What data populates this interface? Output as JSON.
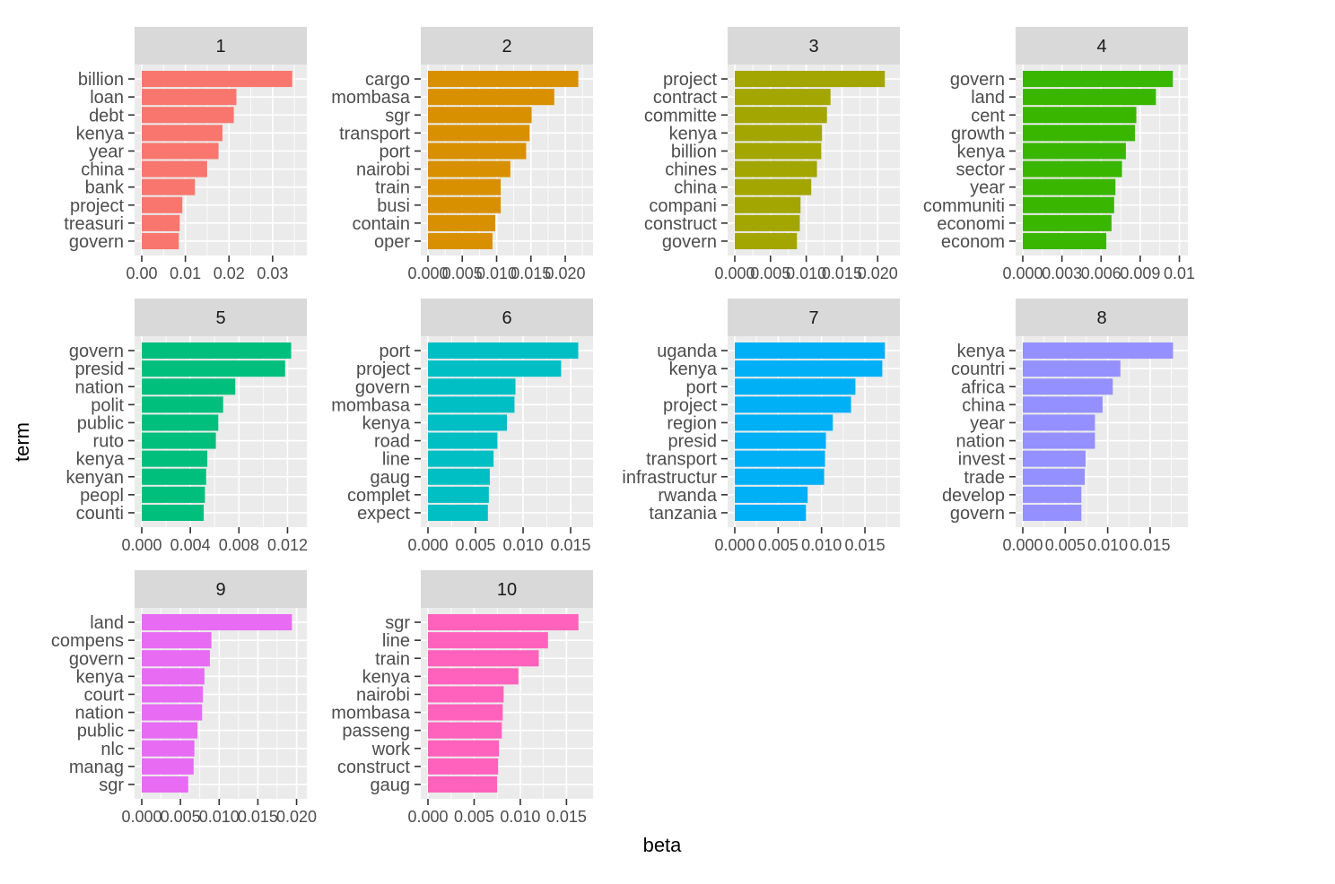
{
  "chart_data": {
    "type": "bar",
    "orientation": "horizontal",
    "layout": "facet_wrap",
    "xlabel": "beta",
    "ylabel": "term",
    "grid": true,
    "legend": "none",
    "panels": [
      {
        "name": "1",
        "color": "#F8766D",
        "ticks": [
          "0.00",
          "0.01",
          "0.02",
          "0.03"
        ],
        "tick_values": [
          0,
          0.01,
          0.02,
          0.03
        ],
        "xlim": [
          0,
          0.0362
        ],
        "terms": [
          "billion",
          "loan",
          "debt",
          "kenya",
          "year",
          "china",
          "bank",
          "project",
          "treasuri",
          "govern"
        ],
        "values": [
          0.0345,
          0.0217,
          0.0211,
          0.0185,
          0.0176,
          0.015,
          0.0122,
          0.0093,
          0.0087,
          0.0085
        ]
      },
      {
        "name": "2",
        "color": "#D89000",
        "ticks": [
          "0.000",
          "0.005",
          "0.010",
          "0.015",
          "0.020"
        ],
        "tick_values": [
          0,
          0.005,
          0.01,
          0.015,
          0.02
        ],
        "xlim": [
          0,
          0.023
        ],
        "terms": [
          "cargo",
          "mombasa",
          "sgr",
          "transport",
          "port",
          "nairobi",
          "train",
          "busi",
          "contain",
          "oper"
        ],
        "values": [
          0.0219,
          0.0184,
          0.0151,
          0.0148,
          0.0143,
          0.012,
          0.0106,
          0.0106,
          0.0098,
          0.0094
        ]
      },
      {
        "name": "3",
        "color": "#A3A500",
        "ticks": [
          "0.000",
          "0.005",
          "0.010",
          "0.015",
          "0.020"
        ],
        "tick_values": [
          0,
          0.005,
          0.01,
          0.015,
          0.02
        ],
        "xlim": [
          0,
          0.0221
        ],
        "terms": [
          "project",
          "contract",
          "committe",
          "kenya",
          "billion",
          "chines",
          "china",
          "compani",
          "construct",
          "govern"
        ],
        "values": [
          0.021,
          0.0134,
          0.0129,
          0.0122,
          0.0121,
          0.0115,
          0.0107,
          0.0092,
          0.0091,
          0.0087
        ]
      },
      {
        "name": "4",
        "color": "#39B600",
        "ticks": [
          "0.000",
          "0.003",
          "0.006",
          "0.009",
          "0.01"
        ],
        "tick_values": [
          0,
          0.003,
          0.006,
          0.009,
          0.012
        ],
        "xlim": [
          0,
          0.0121
        ],
        "terms": [
          "govern",
          "land",
          "cent",
          "growth",
          "kenya",
          "sector",
          "year",
          "communiti",
          "economi",
          "econom"
        ],
        "values": [
          0.0115,
          0.0102,
          0.0087,
          0.0086,
          0.0079,
          0.0076,
          0.0071,
          0.007,
          0.0068,
          0.0064
        ]
      },
      {
        "name": "5",
        "color": "#00BF7D",
        "ticks": [
          "0.000",
          "0.004",
          "0.008",
          "0.012"
        ],
        "tick_values": [
          0,
          0.004,
          0.008,
          0.012
        ],
        "xlim": [
          0,
          0.013
        ],
        "terms": [
          "govern",
          "presid",
          "nation",
          "polit",
          "public",
          "ruto",
          "kenya",
          "kenyan",
          "peopl",
          "counti"
        ],
        "values": [
          0.0123,
          0.0118,
          0.0077,
          0.0067,
          0.0063,
          0.0061,
          0.0054,
          0.0053,
          0.0052,
          0.0051
        ]
      },
      {
        "name": "6",
        "color": "#00BFC4",
        "ticks": [
          "0.000",
          "0.005",
          "0.010",
          "0.015"
        ],
        "tick_values": [
          0,
          0.005,
          0.01,
          0.015
        ],
        "xlim": [
          0,
          0.0166
        ],
        "terms": [
          "port",
          "project",
          "govern",
          "mombasa",
          "kenya",
          "road",
          "line",
          "gaug",
          "complet",
          "expect"
        ],
        "values": [
          0.0158,
          0.014,
          0.0092,
          0.0091,
          0.0083,
          0.0073,
          0.0069,
          0.0065,
          0.0064,
          0.0063
        ]
      },
      {
        "name": "7",
        "color": "#00B0F6",
        "ticks": [
          "0.000",
          "0.005",
          "0.010",
          "0.015"
        ],
        "tick_values": [
          0,
          0.005,
          0.01,
          0.015
        ],
        "xlim": [
          0,
          0.0182
        ],
        "terms": [
          "uganda",
          "kenya",
          "port",
          "project",
          "region",
          "presid",
          "transport",
          "infrastructur",
          "rwanda",
          "tanzania"
        ],
        "values": [
          0.0173,
          0.017,
          0.0139,
          0.0134,
          0.0113,
          0.0105,
          0.0104,
          0.0103,
          0.0084,
          0.0082
        ]
      },
      {
        "name": "8",
        "color": "#9590FF",
        "ticks": [
          "0.000",
          "0.005",
          "0.010",
          "0.015"
        ],
        "tick_values": [
          0,
          0.005,
          0.01,
          0.015
        ],
        "xlim": [
          0,
          0.0186
        ],
        "terms": [
          "kenya",
          "countri",
          "africa",
          "china",
          "year",
          "nation",
          "invest",
          "trade",
          "develop",
          "govern"
        ],
        "values": [
          0.0177,
          0.0115,
          0.0106,
          0.0094,
          0.0085,
          0.0085,
          0.0074,
          0.0073,
          0.0069,
          0.0069
        ]
      },
      {
        "name": "9",
        "color": "#E76BF3",
        "ticks": [
          "0.000",
          "0.005",
          "0.010",
          "0.015",
          "0.020"
        ],
        "tick_values": [
          0,
          0.005,
          0.01,
          0.015,
          0.02
        ],
        "xlim": [
          0,
          0.0204
        ],
        "terms": [
          "land",
          "compens",
          "govern",
          "kenya",
          "court",
          "nation",
          "public",
          "nlc",
          "manag",
          "sgr"
        ],
        "values": [
          0.0194,
          0.009,
          0.0088,
          0.0081,
          0.0079,
          0.0078,
          0.0072,
          0.0068,
          0.0067,
          0.006
        ]
      },
      {
        "name": "10",
        "color": "#FF62BC",
        "ticks": [
          "0.000",
          "0.005",
          "0.010",
          "0.015"
        ],
        "tick_values": [
          0,
          0.005,
          0.01,
          0.015
        ],
        "xlim": [
          0,
          0.0171
        ],
        "terms": [
          "sgr",
          "line",
          "train",
          "kenya",
          "nairobi",
          "mombasa",
          "passeng",
          "work",
          "construct",
          "gaug"
        ],
        "values": [
          0.0163,
          0.013,
          0.012,
          0.0098,
          0.0082,
          0.0081,
          0.008,
          0.0077,
          0.0076,
          0.0075
        ]
      }
    ]
  }
}
